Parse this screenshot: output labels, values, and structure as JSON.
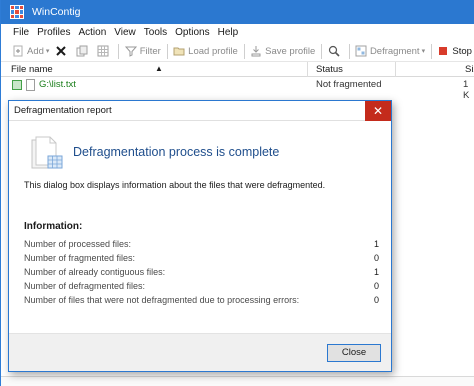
{
  "window": {
    "title": "WinContig"
  },
  "menu": [
    "File",
    "Profiles",
    "Action",
    "View",
    "Tools",
    "Options",
    "Help"
  ],
  "toolbar": {
    "add": "Add",
    "filter": "Filter",
    "load_profile": "Load profile",
    "save_profile": "Save profile",
    "defragment": "Defragment",
    "stop": "Stop",
    "dropdown_arrow": "▾"
  },
  "columns": {
    "file_name": "File name",
    "status": "Status",
    "size": "Siz",
    "sort_indicator": "▲"
  },
  "files": [
    {
      "name": "G:\\list.txt",
      "status": "Not fragmented",
      "size": "1 K"
    }
  ],
  "dialog": {
    "title": "Defragmentation report",
    "close_glyph": "✕",
    "heading": "Defragmentation process is complete",
    "description": "This dialog box displays information about the files that were defragmented.",
    "info_label": "Information:",
    "stats": [
      {
        "label": "Number of processed files:",
        "value": "1"
      },
      {
        "label": "Number of fragmented files:",
        "value": "0"
      },
      {
        "label": "Number of already contiguous files:",
        "value": "1"
      },
      {
        "label": "Number of defragmented files:",
        "value": "0"
      },
      {
        "label": "Number of files that were not defragmented due to processing errors:",
        "value": "0"
      }
    ],
    "close_button": "Close"
  },
  "colors": {
    "titlebar": "#2b78d0",
    "close": "#c42b1c",
    "heading": "#1f4e8c",
    "filename": "#1a7d1a"
  }
}
